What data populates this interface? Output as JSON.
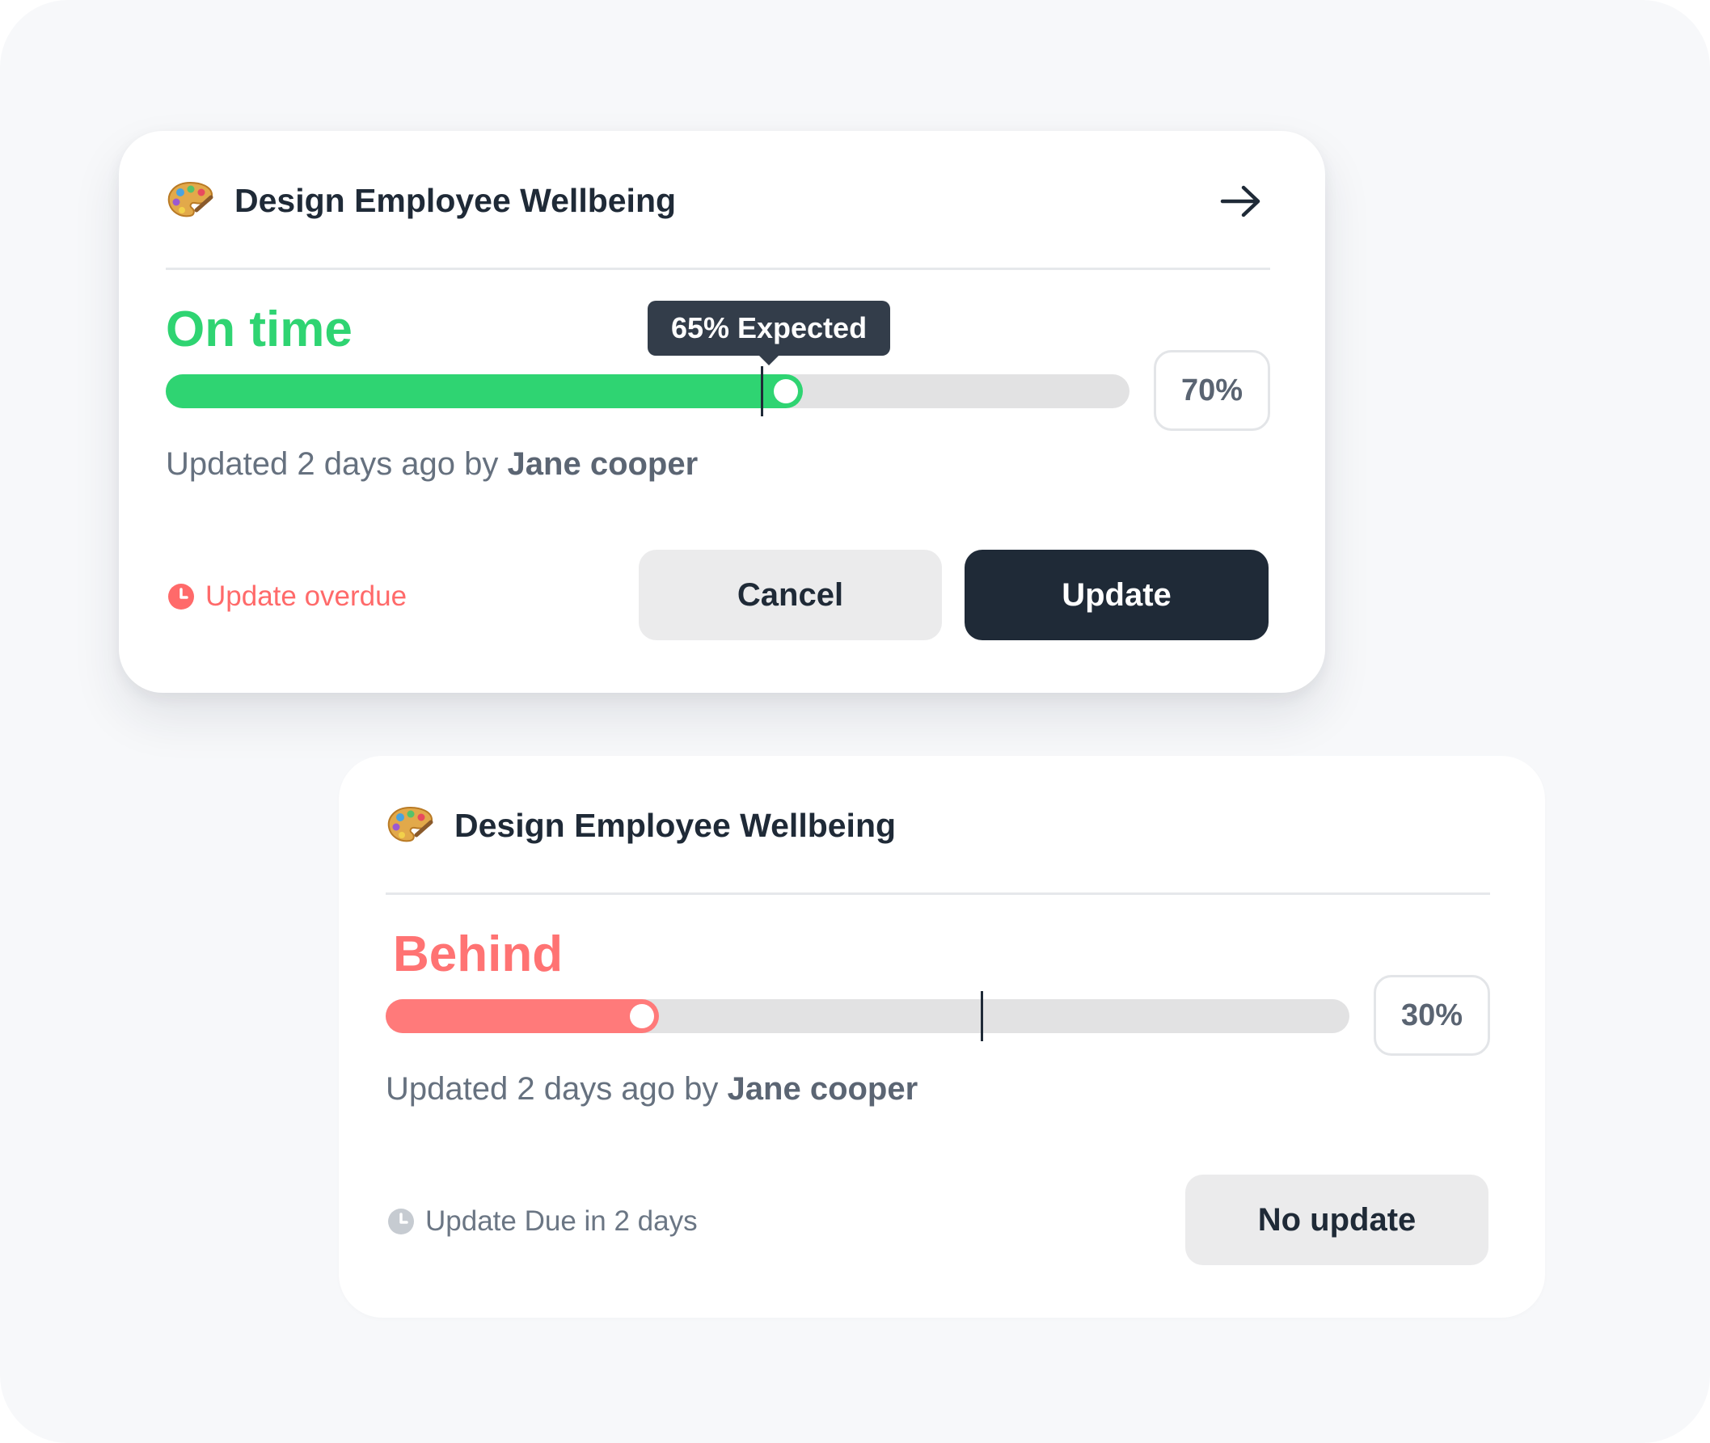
{
  "cards": [
    {
      "title": "Design Employee Wellbeing",
      "icon": "palette-icon",
      "status": "On time",
      "status_color": "#2fd472",
      "progress": 0.7,
      "expected": 0.65,
      "tooltip": "65% Expected",
      "percent_label": "70%",
      "updated_prefix": "Updated 2 days ago by",
      "updated_by": "Jane cooper",
      "note": "Update overdue",
      "note_color": "#ff6a6a",
      "note_icon": "clock-icon",
      "buttons": {
        "cancel": "Cancel",
        "update": "Update"
      },
      "open_icon": "arrow-right-icon"
    },
    {
      "title": "Design Employee Wellbeing",
      "icon": "palette-icon",
      "status": "Behind",
      "status_color": "#ff7373",
      "progress": 0.3,
      "expected": 0.65,
      "percent_label": "30%",
      "updated_prefix": "Updated 2 days ago by",
      "updated_by": "Jane cooper",
      "note": "Update Due in 2 days",
      "note_color": "#6b7684",
      "note_icon": "clock-icon",
      "buttons": {
        "no_update": "No update"
      }
    }
  ]
}
